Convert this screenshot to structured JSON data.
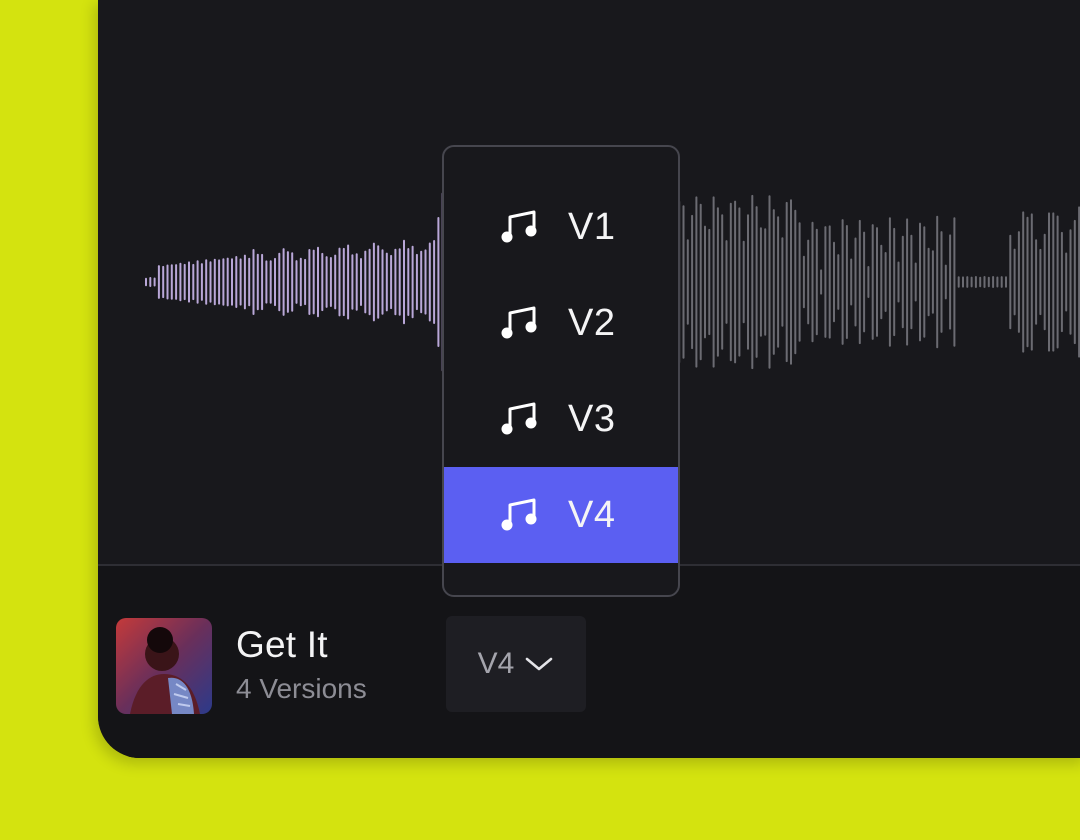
{
  "player": {
    "track_title": "Get It",
    "track_subtitle": "4 Versions",
    "selected_version": "V4"
  },
  "version_menu": {
    "items": [
      {
        "label": "V1",
        "icon": "music-note-icon"
      },
      {
        "label": "V2",
        "icon": "music-note-icon"
      },
      {
        "label": "V3",
        "icon": "music-note-icon"
      },
      {
        "label": "V4",
        "icon": "music-note-icon"
      }
    ],
    "selected_index": 3
  },
  "colors": {
    "background": "#d4e30f",
    "panel": "#18181c",
    "footer": "#141417",
    "accent": "#5b5ff2",
    "waveform_played": "#b9a7d8",
    "waveform_unplayed": "#6b6b72"
  },
  "waveform": {
    "played_fraction": 0.42
  }
}
